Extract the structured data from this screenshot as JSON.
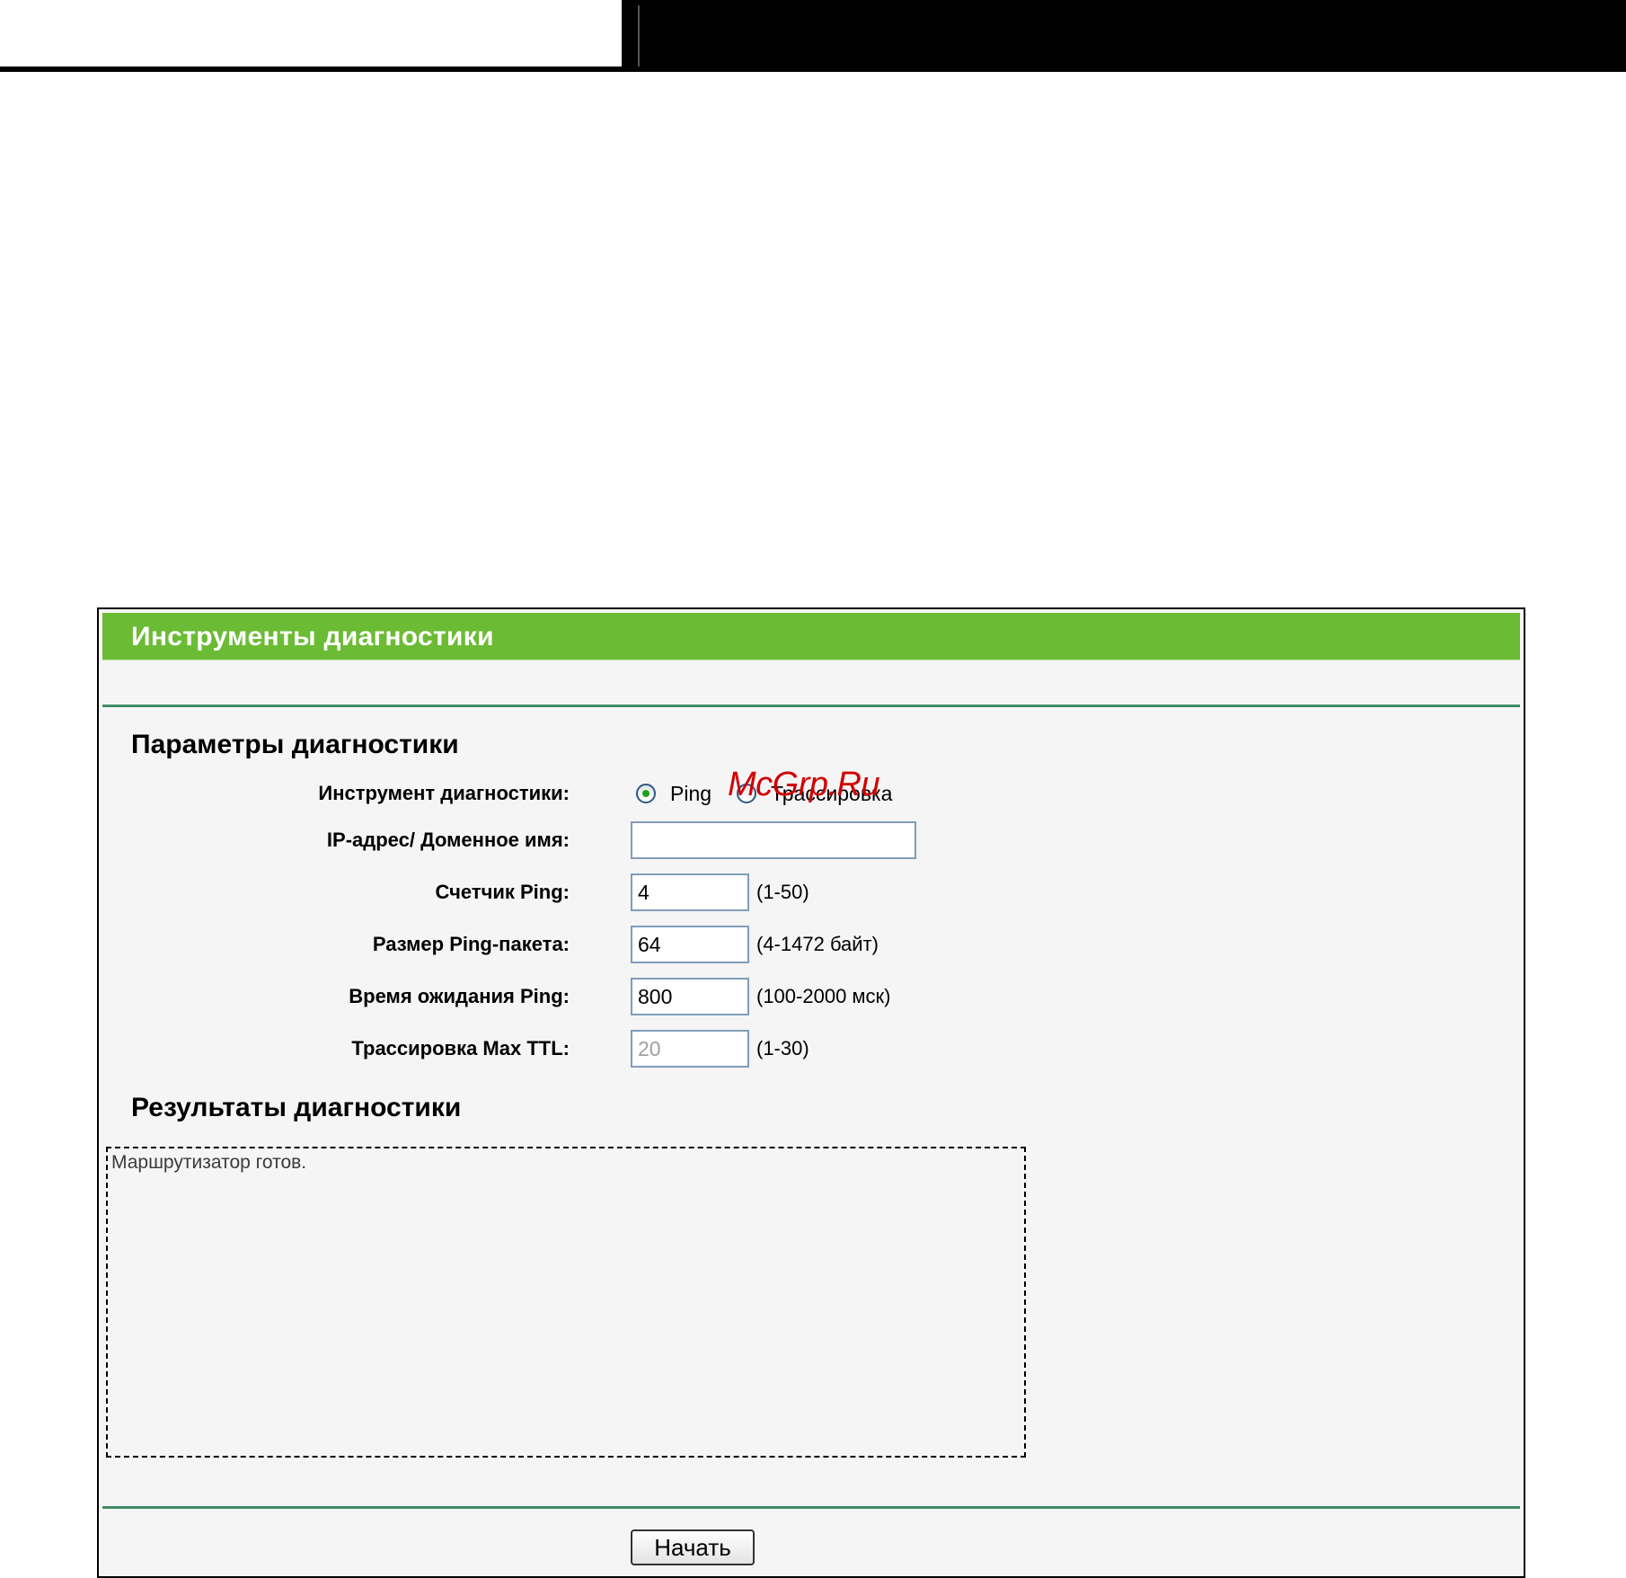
{
  "page": {
    "panel_title": "Инструменты диагностики",
    "watermark": "McGrp.Ru"
  },
  "diagnostic_params": {
    "section_title": "Параметры диагностики",
    "tool_label": "Инструмент диагностики:",
    "tool_options": [
      {
        "label": "Ping",
        "selected": true
      },
      {
        "label": "Трассировка",
        "selected": false
      }
    ],
    "address_label": "IP-адрес/ Доменное имя:",
    "address_value": "",
    "ping_count_label": "Счетчик Ping:",
    "ping_count_value": "4",
    "ping_count_range": "(1-50)",
    "ping_size_label": "Размер Ping-пакета:",
    "ping_size_value": "64",
    "ping_size_range": "(4-1472 байт)",
    "ping_timeout_label": "Время ожидания Ping:",
    "ping_timeout_value": "800",
    "ping_timeout_range": "(100-2000 мск)",
    "trace_ttl_label": "Трассировка Max TTL:",
    "trace_ttl_value": "20",
    "trace_ttl_range": "(1-30)"
  },
  "diagnostic_results": {
    "section_title": "Результаты диагностики",
    "text": "Маршрутизатор готов."
  },
  "actions": {
    "start_label": "Начать"
  },
  "colors": {
    "header_green": "#6bbc34",
    "divider_green": "#3f8d67",
    "panel_bg": "#f5f5f5",
    "watermark_red": "#d20000"
  }
}
